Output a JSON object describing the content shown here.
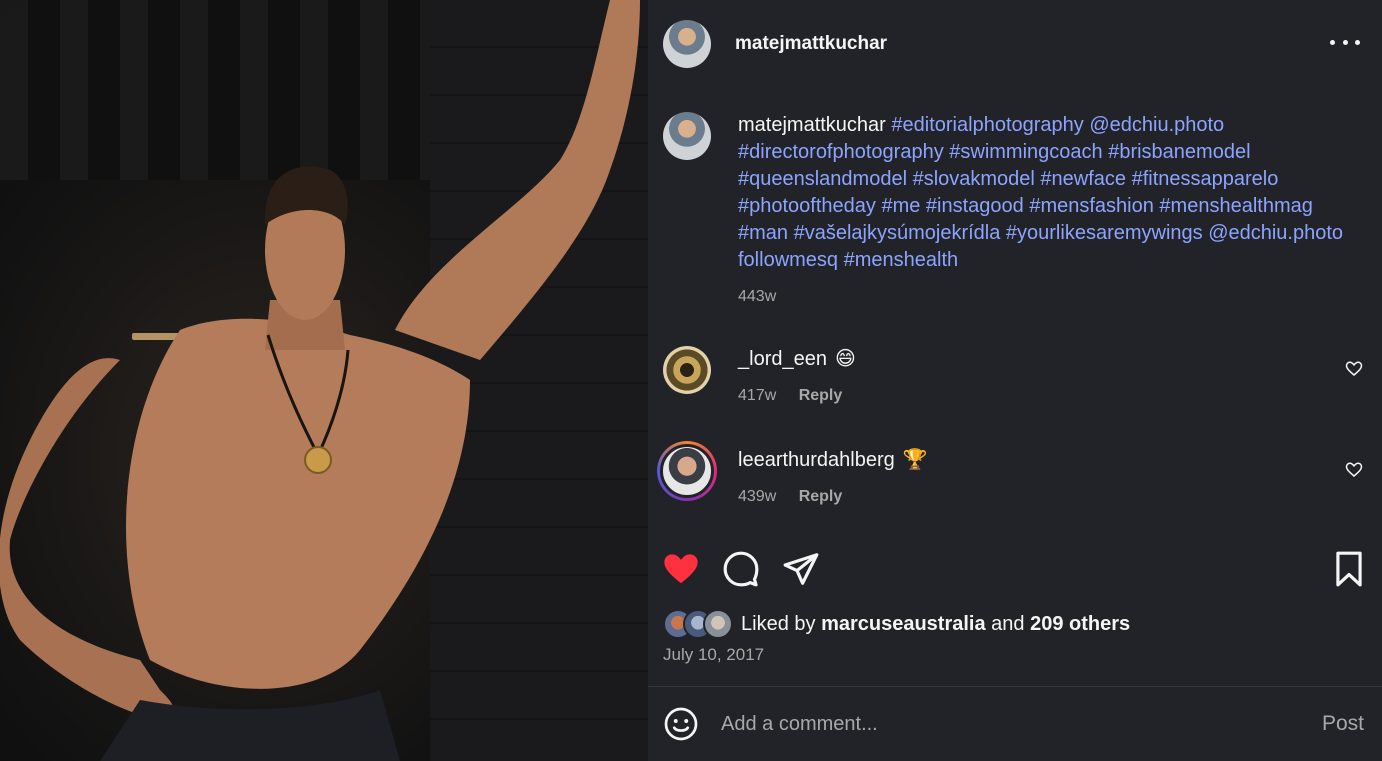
{
  "post": {
    "author": "matejmattkuchar",
    "caption_author": "matejmattkuchar",
    "caption_tags": "#editorialphotography @edchiu.photo #directorofphotography #swimmingcoach #brisbanemodel #queenslandmodel #slovakmodel #newface #fitnessapparelo #photooftheday #me #instagood #mensfashion #menshealthmag #man #vašelajkysúmojekrídla #yourlikesaremywings @edchiu.photo followmesq #menshealth",
    "caption_age": "443w",
    "liked": true
  },
  "comments": [
    {
      "username": "_lord_een",
      "emoji": "😄",
      "age": "417w",
      "reply_label": "Reply"
    },
    {
      "username": "leearthurdahlberg",
      "emoji": "🏆",
      "age": "439w",
      "reply_label": "Reply"
    }
  ],
  "likes": {
    "prefix": "Liked by",
    "first_liker": "marcuseaustralia",
    "conjunction": "and",
    "others": "209 others"
  },
  "date": "July 10, 2017",
  "composer": {
    "placeholder": "Add a comment...",
    "post_label": "Post"
  },
  "colors": {
    "panel_bg": "#212328",
    "hashtag": "#8da4ff",
    "like_red": "#ff3040",
    "muted": "#a8a8a8"
  }
}
